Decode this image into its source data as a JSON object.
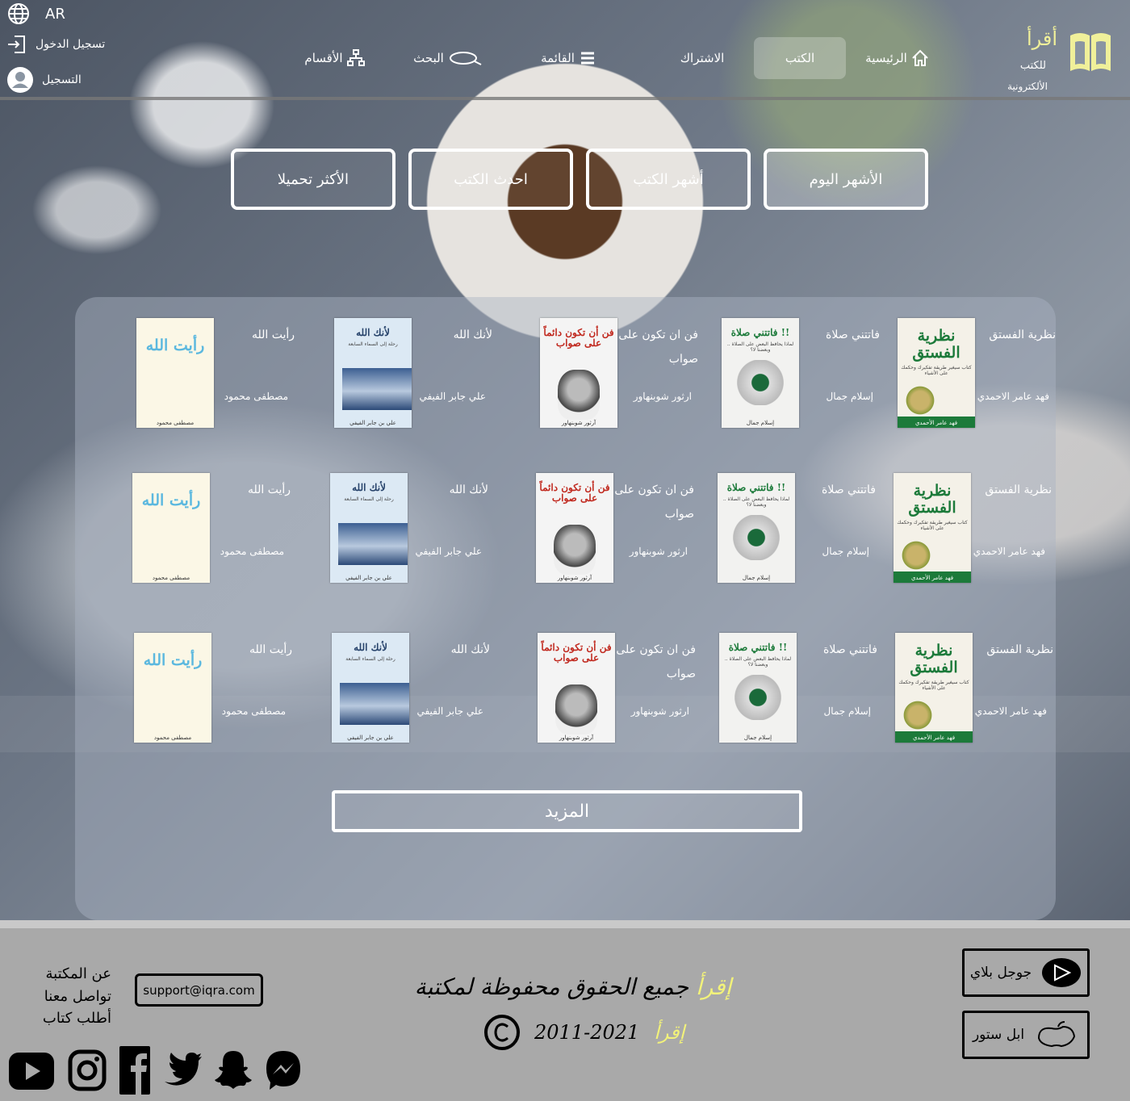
{
  "header": {
    "logo_title": "أقرأ",
    "logo_sub1": "للكتب",
    "logo_sub2": "الألكترونية",
    "nav": [
      {
        "label": "الرئيسية",
        "icon": "home-icon"
      },
      {
        "label": "الكتب",
        "active": true
      },
      {
        "label": "الاشتراك"
      },
      {
        "label": "القائمة",
        "icon": "menu-icon"
      },
      {
        "label": "البحث",
        "icon": "search-icon"
      },
      {
        "label": "الأقسام",
        "icon": "sitemap-icon"
      }
    ],
    "lang": "AR",
    "login": "تسجيل الدخول",
    "register": "التسجيل"
  },
  "tabs": [
    {
      "label": "الأشهر اليوم",
      "active": true
    },
    {
      "label": "أشهر الكتب"
    },
    {
      "label": "احدث الكتب"
    },
    {
      "label": "الأكثر تحميلا"
    }
  ],
  "books": [
    {
      "title": "نظرية الفستق",
      "author": "فهد عامر الاحمدي",
      "cover_title": "نظرية الفستق",
      "cover_sub": "كتاب سيغير طريقة تفكيرك وحكمك على الأشياء",
      "cover_author": "فهد عامر الأحمدي"
    },
    {
      "title": "فاتتني صلاة",
      "author": "إسلام جمال",
      "cover_title": "فاتتني صلاة !!",
      "cover_sub": "لماذا يحافظ البعض على الصلاة .. وبعضنا لا؟",
      "cover_author": "إسلام جمال"
    },
    {
      "title": "فن ان تكون على صواب",
      "author": "ارثور شوبنهاور",
      "cover_title": "فن أن تكون دائماً على صواب",
      "cover_sub": "",
      "cover_author": "آرثور شوبنهاور"
    },
    {
      "title": "لأنك الله",
      "author": "علي جابر الفيفي",
      "cover_title": "لأنك الله",
      "cover_sub": "رحلة إلى السماء السابعة",
      "cover_author": "علي بن جابر الفيفي"
    },
    {
      "title": "رأيت الله",
      "author": "مصطفى محمود",
      "cover_title": "رأيت الله",
      "cover_sub": "",
      "cover_author": "مصطفى محمود"
    }
  ],
  "more_label": "المزيد",
  "footer": {
    "google_play": "جوجل بلاي",
    "app_store": "ابل ستور",
    "copyright_text": "جميع الحقوق محفوظة لمكتبة",
    "copyright_brand": "إقرأ",
    "years": "2011-2021",
    "brand2": "إقرأ",
    "email": "support@iqra.com",
    "links": [
      "عن المكتبة",
      "تواصل معنا",
      "أطلب كتاب"
    ],
    "socials": [
      "youtube-icon",
      "instagram-icon",
      "facebook-icon",
      "twitter-icon",
      "snapchat-icon",
      "messenger-icon"
    ]
  },
  "colors": {
    "accent_yellow": "#f2f27a",
    "logo_yellow": "#f0f09a",
    "footer_bg": "#a9a9a9"
  }
}
